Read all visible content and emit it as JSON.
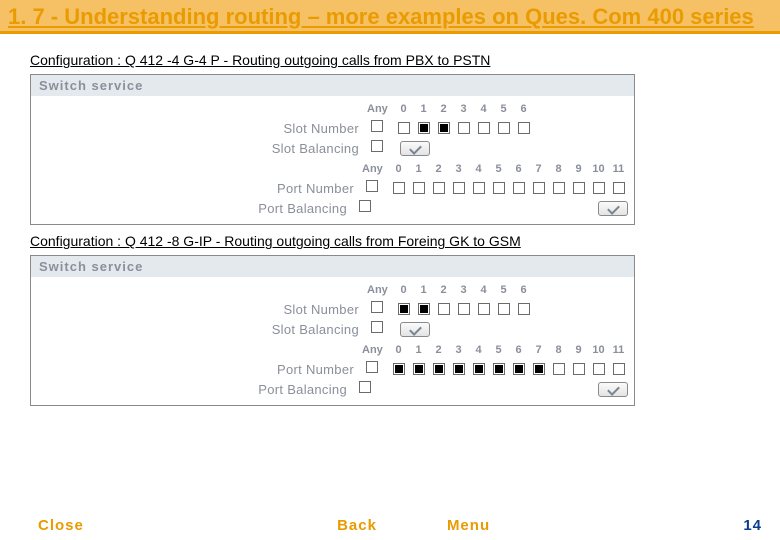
{
  "title": "1. 7 - Understanding routing – more examples on Ques. Com 400 series",
  "config1_caption": "Configuration : Q 412 -4 G-4 P - Routing outgoing calls from PBX to PSTN",
  "config2_caption": "Configuration : Q 412 -8 G-IP - Routing outgoing calls from Foreing GK to GSM",
  "panel1": {
    "header": "Switch service",
    "slots_header": [
      "Any",
      "0",
      "1",
      "2",
      "3",
      "4",
      "5",
      "6"
    ],
    "ports_header": [
      "Any",
      "0",
      "1",
      "2",
      "3",
      "4",
      "5",
      "6",
      "7",
      "8",
      "9",
      "10",
      "11"
    ],
    "labels": {
      "slot_number": "Slot Number",
      "slot_balancing": "Slot Balancing",
      "port_number": "Port Number",
      "port_balancing": "Port Balancing"
    },
    "slot_any": false,
    "slot_checks": [
      false,
      true,
      true,
      false,
      false,
      false,
      false
    ],
    "slot_balancing_any": false,
    "port_any": false,
    "port_checks": [
      false,
      false,
      false,
      false,
      false,
      false,
      false,
      false,
      false,
      false,
      false,
      false
    ],
    "port_balancing_any": false
  },
  "panel2": {
    "header": "Switch service",
    "slots_header": [
      "Any",
      "0",
      "1",
      "2",
      "3",
      "4",
      "5",
      "6"
    ],
    "ports_header": [
      "Any",
      "0",
      "1",
      "2",
      "3",
      "4",
      "5",
      "6",
      "7",
      "8",
      "9",
      "10",
      "11"
    ],
    "labels": {
      "slot_number": "Slot Number",
      "slot_balancing": "Slot Balancing",
      "port_number": "Port Number",
      "port_balancing": "Port Balancing"
    },
    "slot_any": false,
    "slot_checks": [
      true,
      true,
      false,
      false,
      false,
      false,
      false
    ],
    "slot_balancing_any": false,
    "port_any": false,
    "port_checks": [
      true,
      true,
      true,
      true,
      true,
      true,
      true,
      true,
      false,
      false,
      false,
      false
    ],
    "port_balancing_any": false
  },
  "footer": {
    "close": "Close",
    "back": "Back",
    "menu": "Menu",
    "page": "14"
  }
}
